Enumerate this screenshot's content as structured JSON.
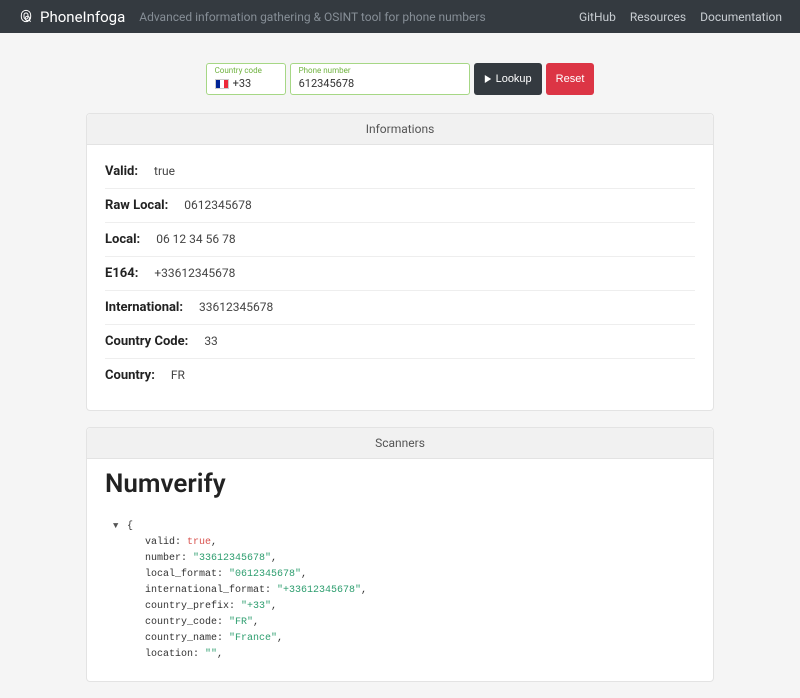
{
  "nav": {
    "brand": "PhoneInfoga",
    "tagline": "Advanced information gathering & OSINT tool for phone numbers",
    "links": [
      "GitHub",
      "Resources",
      "Documentation"
    ]
  },
  "form": {
    "cc_label": "Country code",
    "cc_value": "+33",
    "pn_label": "Phone number",
    "pn_value": "612345678",
    "lookup": "Lookup",
    "reset": "Reset"
  },
  "info": {
    "header": "Informations",
    "rows": [
      {
        "label": "Valid:",
        "value": "true"
      },
      {
        "label": "Raw Local:",
        "value": "0612345678"
      },
      {
        "label": "Local:",
        "value": "06 12 34 56 78"
      },
      {
        "label": "E164:",
        "value": "+33612345678"
      },
      {
        "label": "International:",
        "value": "33612345678"
      },
      {
        "label": "Country Code:",
        "value": "33"
      },
      {
        "label": "Country:",
        "value": "FR"
      }
    ]
  },
  "scanners": {
    "header": "Scanners",
    "title": "Numverify",
    "json": {
      "valid": "true",
      "number": "\"33612345678\"",
      "local_format": "\"0612345678\"",
      "international_format": "\"+33612345678\"",
      "country_prefix": "\"+33\"",
      "country_code": "\"FR\"",
      "country_name": "\"France\"",
      "location": "\"\""
    }
  }
}
